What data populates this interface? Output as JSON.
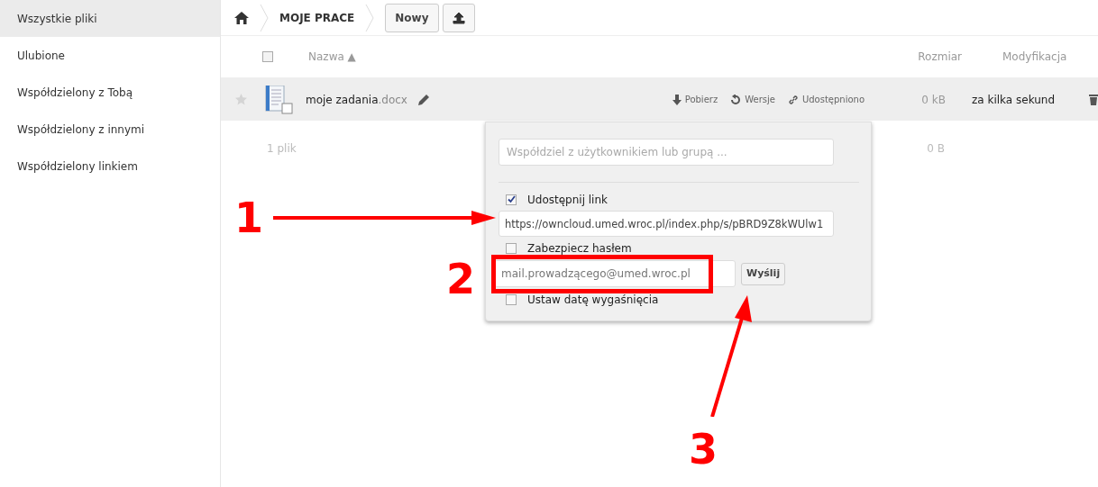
{
  "sidebar": {
    "items": [
      {
        "label": "Wszystkie pliki",
        "selected": true
      },
      {
        "label": "Ulubione",
        "selected": false
      },
      {
        "label": "Współdzielony z Tobą",
        "selected": false
      },
      {
        "label": "Współdzielony z innymi",
        "selected": false
      },
      {
        "label": "Współdzielony linkiem",
        "selected": false
      }
    ]
  },
  "breadcrumb": {
    "folder": "MOJE PRACE",
    "new_button": "Nowy"
  },
  "table": {
    "columns": [
      "Nazwa ▲",
      "Rozmiar",
      "Modyfikacja"
    ],
    "select_all_checked": false,
    "rows": [
      {
        "name": "moje zadania",
        "extension": ".docx",
        "favorite": false,
        "actions": [
          "Pobierz",
          "Wersje",
          "Udostępniono"
        ],
        "size": "0 kB",
        "modified": "za kilka sekund"
      }
    ],
    "summary": {
      "count": "1 plik",
      "size": "0 B"
    }
  },
  "share_popup": {
    "share_placeholder": "Współdziel z użytkownikiem lub grupą ...",
    "options": [
      {
        "kind": "checkbox",
        "label": "Udostępnij link",
        "checked": true
      },
      {
        "kind": "field",
        "value": "https://owncloud.umed.wroc.pl/index.php/s/pBRD9Z8kWUlw1"
      },
      {
        "kind": "checkbox",
        "label": "Zabezpiecz hasłem",
        "checked": false
      },
      {
        "kind": "email",
        "value": "mail.prowadzącego@umed.wroc.pl",
        "button": "Wyślij"
      },
      {
        "kind": "checkbox",
        "label": "Ustaw datę wygaśnięcia",
        "checked": false
      }
    ]
  },
  "annotations": [
    "1",
    "2",
    "3"
  ]
}
